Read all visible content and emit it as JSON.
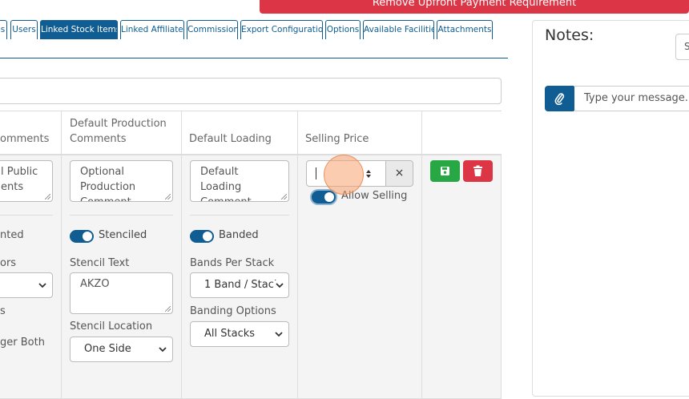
{
  "banner": {
    "remove_upfront_label": "Remove Upfront Payment Requirement"
  },
  "tabs": [
    {
      "label": "s"
    },
    {
      "label": "Users"
    },
    {
      "label": "Linked Stock Items"
    },
    {
      "label": "Linked Affiliates"
    },
    {
      "label": "Commission"
    },
    {
      "label": "Export Configuration"
    },
    {
      "label": "Options"
    },
    {
      "label": "Available Facilities"
    },
    {
      "label": "Attachments"
    }
  ],
  "active_tab": "Linked Stock Items",
  "table": {
    "headers": {
      "comments": "omments",
      "production": "Default Production Comments",
      "loading": "Default Loading",
      "selling": "Selling Price"
    },
    "col1": {
      "public_comment": "l Public\nents",
      "toggle_label": "nted",
      "colors_label": "ors",
      "s_label": "s",
      "ger_both": "ger Both"
    },
    "col2": {
      "production_comment_placeholder": "Optional Production Comment",
      "stenciled_label": "Stenciled",
      "stencil_text_label": "Stencil Text",
      "stencil_text_value": "AKZO",
      "stencil_location_label": "Stencil Location",
      "stencil_location_value": "One Side"
    },
    "col3": {
      "loading_comment_placeholder": "Default Loading Comment",
      "banded_label": "Banded",
      "bands_per_stack_label": "Bands Per Stack",
      "bands_per_stack_value": "1 Band / Stack",
      "banding_options_label": "Banding Options",
      "banding_options_value": "All Stacks"
    },
    "col4": {
      "price_value": "",
      "clear_symbol": "×",
      "allow_selling_label": "Allow Selling"
    }
  },
  "notes": {
    "title": "Notes:",
    "select_value": "S",
    "message_placeholder": "Type your message..."
  },
  "colors": {
    "primary": "#0f5d92",
    "danger": "#dc3545",
    "success": "#28a745"
  }
}
